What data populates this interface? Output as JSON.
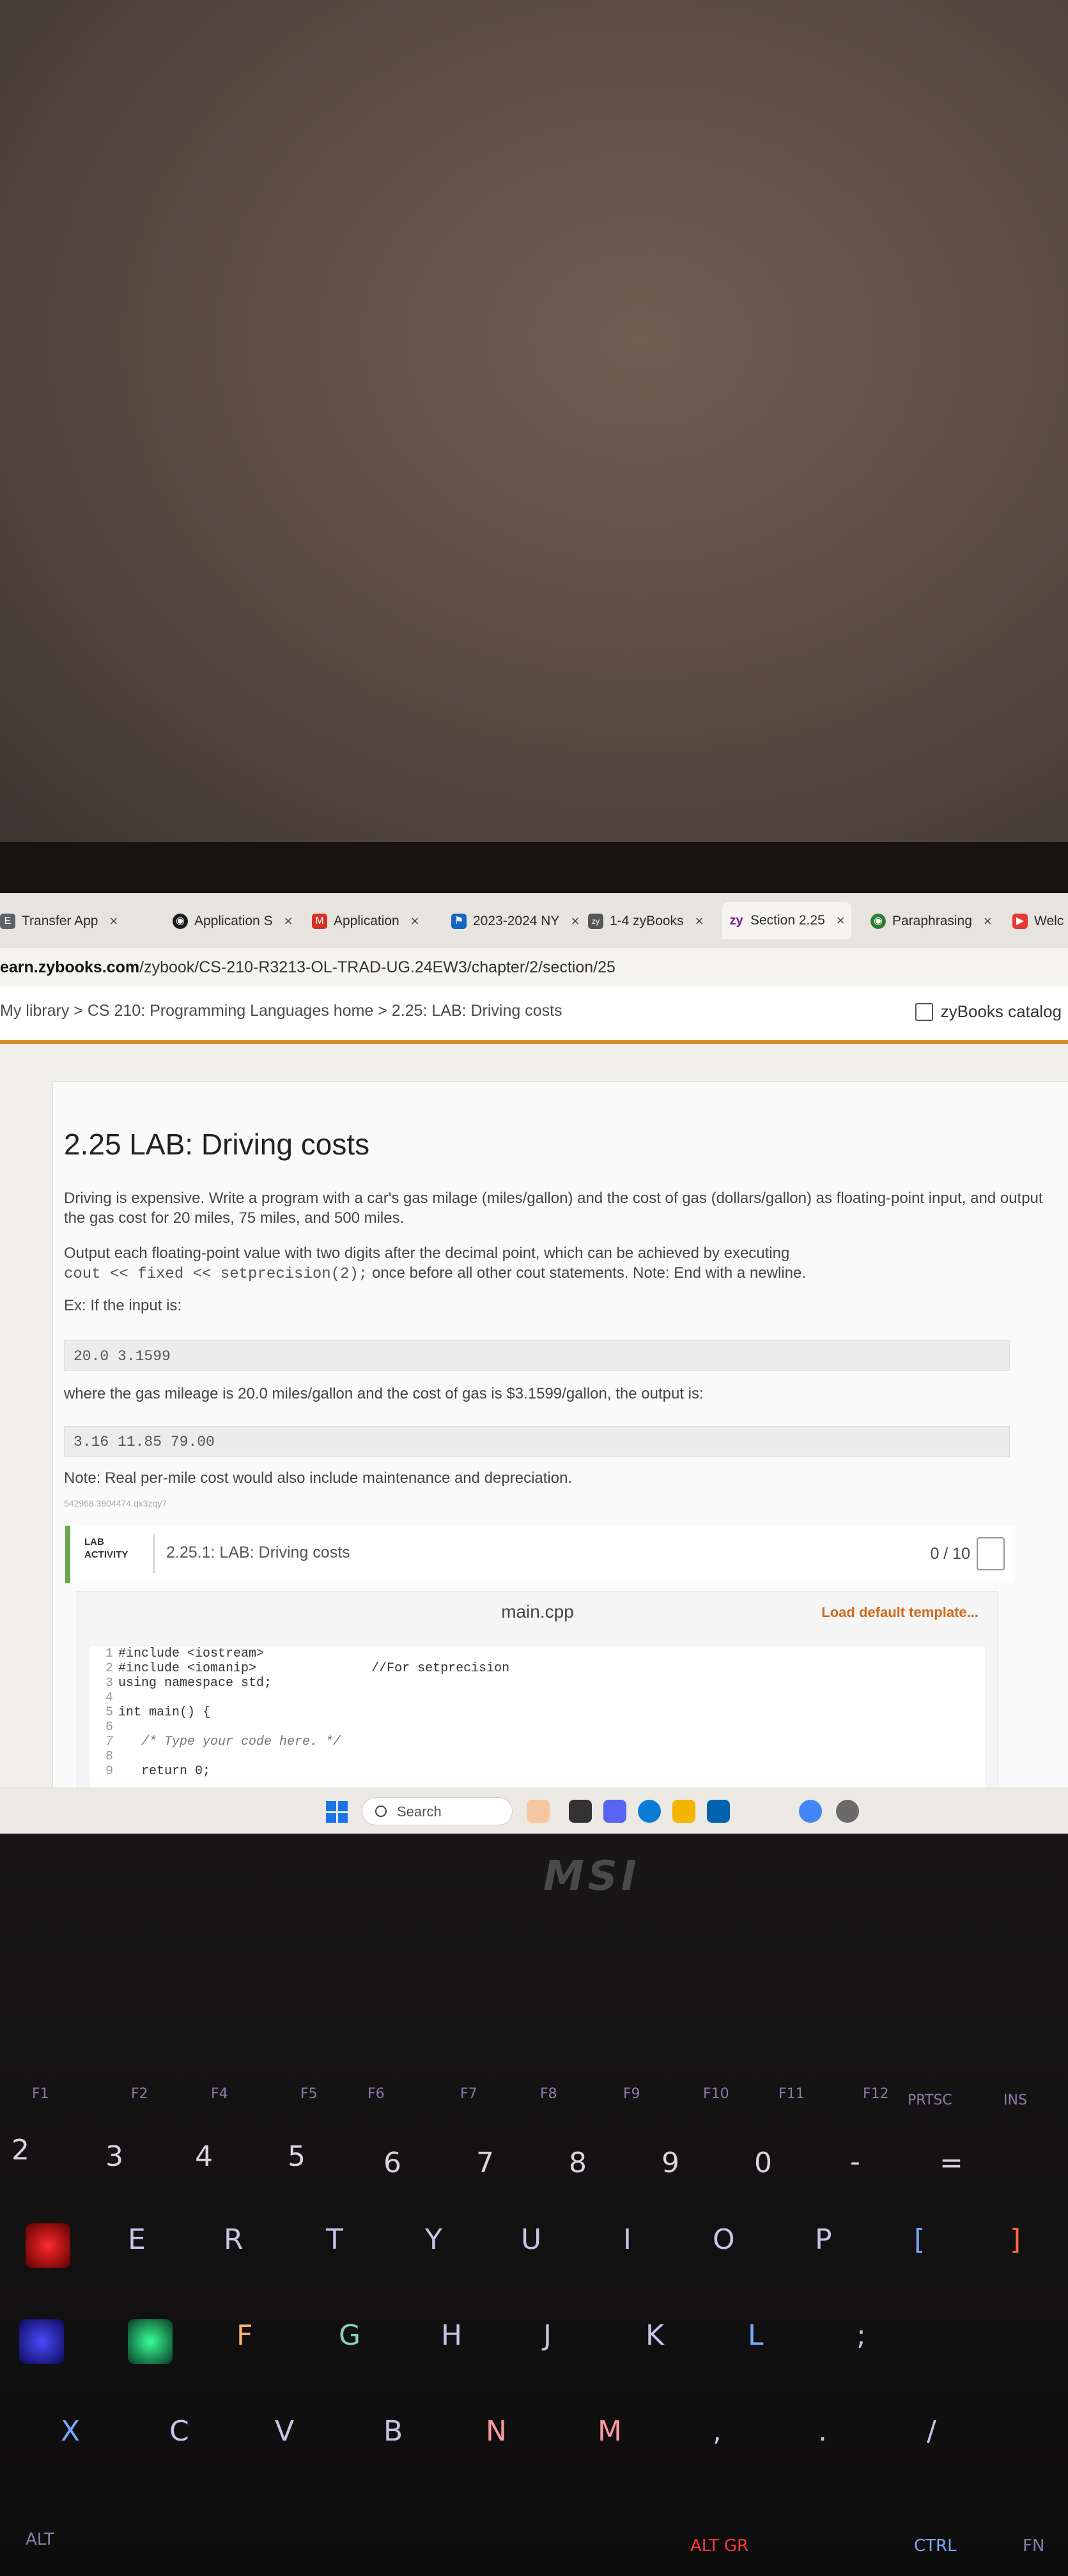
{
  "browser": {
    "tabs": [
      {
        "label": "Transfer App",
        "color": "#e8eaf6"
      },
      {
        "label": "Application S",
        "color": "#1b1b1b"
      },
      {
        "label": "Application",
        "color": "#d93025"
      },
      {
        "label": "2023-2024 NY",
        "color": "#1565c0"
      },
      {
        "label": "1-4 zyBooks",
        "color": "#555555"
      },
      {
        "label": "Section 2.25",
        "color": "#7b1fa2",
        "active": true
      },
      {
        "label": "Paraphrasing",
        "color": "#2e7d32"
      },
      {
        "label": "Welc",
        "color": "#e53935"
      }
    ],
    "tab_prefix_icons": {
      "transfer": "E",
      "app1": "◉",
      "app2": "M",
      "nysed": "📍",
      "zybooks": "zy",
      "zy_section": "zy",
      "quillbot": "◉",
      "welc": "▶"
    },
    "url": {
      "domain": "earn.zybooks.com",
      "path": "/zybook/CS-210-R3213-OL-TRAD-UG.24EW3/chapter/2/section/25"
    }
  },
  "crumbs": {
    "text": "My library > CS 210: Programming Languages home > 2.25: LAB: Driving costs",
    "catalog_label": "zyBooks catalog"
  },
  "lab": {
    "title": "2.25 LAB: Driving costs",
    "p1": "Driving is expensive. Write a program with a car's gas milage (miles/gallon) and the cost of gas (dollars/gallon) as floating-point input, and output the gas cost for 20 miles, 75 miles, and 500 miles.",
    "p2": "Output each floating-point value with two digits after the decimal point, which can be achieved by executing",
    "p2_code": "cout << fixed << setprecision(2);",
    "p2_tail": " once before all other cout statements. Note: End with a newline.",
    "ex_label": "Ex: If the input is:",
    "input_example": "20.0 3.1599",
    "where_text": "where the gas mileage is 20.0 miles/gallon and the cost of gas is $3.1599/gallon, the output is:",
    "output_example": "3.16 11.85 79.00",
    "note": "Note: Real per-mile cost would also include maintenance and depreciation.",
    "id_code": "542968.3904474.qx3zqy7",
    "activity_tag_1": "LAB",
    "activity_tag_2": "ACTIVITY",
    "activity_name": "2.25.1: LAB: Driving costs",
    "score": "0 / 10",
    "filename": "main.cpp",
    "load_template": "Load default template...",
    "code_lines": [
      {
        "n": "1",
        "text": "#include <iostream>"
      },
      {
        "n": "2",
        "text": "#include <iomanip>               //For setprecision"
      },
      {
        "n": "3",
        "text": "using namespace std;"
      },
      {
        "n": "4",
        "text": ""
      },
      {
        "n": "5",
        "text": "int main() {"
      },
      {
        "n": "6",
        "text": ""
      },
      {
        "n": "7",
        "text": "   /* Type your code here. */"
      },
      {
        "n": "8",
        "text": ""
      },
      {
        "n": "9",
        "text": "   return 0;"
      }
    ]
  },
  "taskbar": {
    "search_placeholder": "Search"
  },
  "laptop": {
    "brand": "MSI",
    "fkeys": [
      "F1",
      "F2",
      "F4",
      "F5",
      "F6",
      "F7",
      "F8",
      "F9",
      "F10",
      "F11",
      "F12",
      "PRTSC",
      "INS"
    ],
    "numbers": [
      "2",
      "3",
      "4",
      "5",
      "6",
      "7",
      "8",
      "9",
      "0",
      "-",
      "="
    ],
    "row_q": [
      "E",
      "R",
      "T",
      "Y",
      "U",
      "I",
      "O",
      "P",
      "[",
      "]"
    ],
    "row_a": [
      "F",
      "G",
      "H",
      "J",
      "K",
      "L",
      ";"
    ],
    "row_z": [
      "X",
      "C",
      "V",
      "B",
      "N",
      "M",
      ",",
      ".",
      "/"
    ],
    "bottom": [
      "ALT",
      "ALT GR",
      "CTRL",
      "FN"
    ]
  }
}
